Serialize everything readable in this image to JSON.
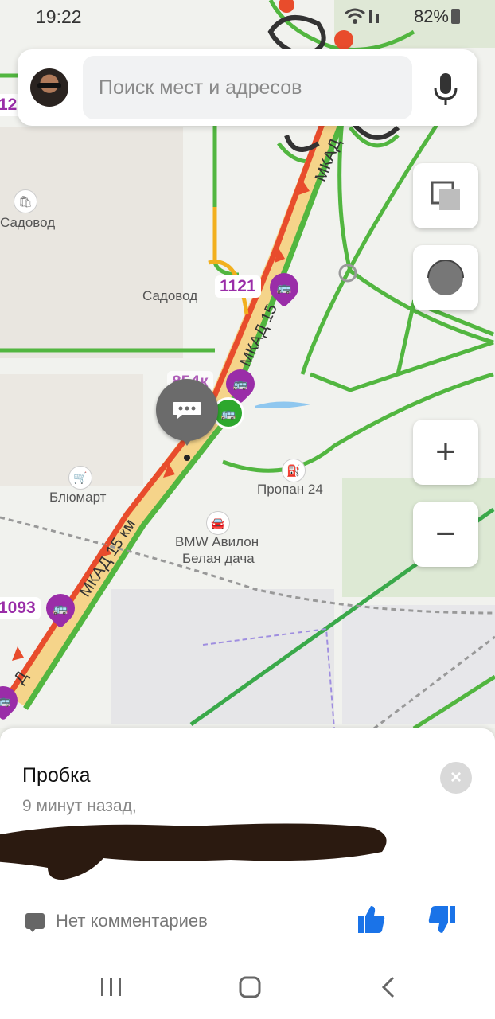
{
  "status_bar": {
    "time": "19:22",
    "battery": "82%"
  },
  "search": {
    "placeholder": "Поиск мест и адресов"
  },
  "map": {
    "labels": {
      "sadovod_left": "Садовод",
      "sadovod_mid": "Садовод",
      "blumart": "Блюмарт",
      "propan": "Пропан 24",
      "bmw_line1": "BMW Авилон",
      "bmw_line2": "Белая дача"
    },
    "roads": {
      "mkad_top": "МКАД",
      "mkad_15_mid": "МКАД 15",
      "mkad_15km": "МКАД 15 км",
      "mkad_bottom": "Д"
    },
    "routes": {
      "r1121": "1121",
      "r854k": "854к",
      "r1093": "1093",
      "r12": "12"
    },
    "bus_glyph": "🚌",
    "bus_green_glyph": "🚌"
  },
  "map_controls": {
    "zoom_in": "+",
    "zoom_out": "−"
  },
  "sheet": {
    "title": "Пробка",
    "subtitle": "9 минут назад,",
    "comments_label": "Нет комментариев",
    "close_glyph": "×"
  },
  "colors": {
    "accent_blue": "#1a73e8",
    "traffic_red": "#e84c2c",
    "traffic_green": "#52b640",
    "route_purple": "#9a2da8"
  }
}
